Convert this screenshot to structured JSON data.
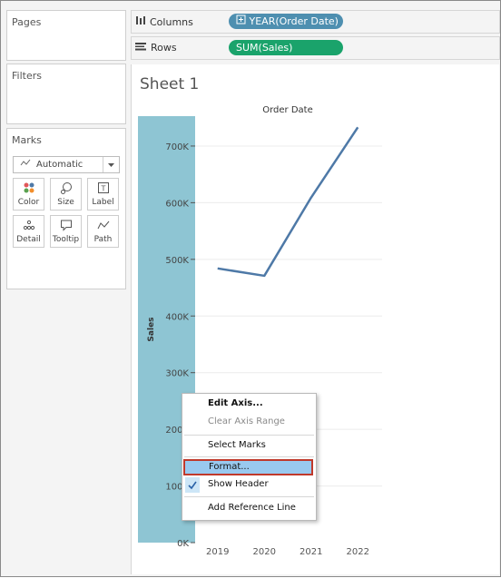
{
  "panels": {
    "pages_title": "Pages",
    "filters_title": "Filters",
    "marks_title": "Marks"
  },
  "shelves": {
    "columns_label": "Columns",
    "columns_pill": "YEAR(Order Date)",
    "rows_label": "Rows",
    "rows_pill": "SUM(Sales)"
  },
  "marks": {
    "type_selected": "Automatic",
    "buttons": [
      "Color",
      "Size",
      "Label",
      "Detail",
      "Tooltip",
      "Path"
    ]
  },
  "sheet": {
    "title": "Sheet 1"
  },
  "colors": {
    "axis_highlight": "#8ec5d3",
    "line": "#4e79a7",
    "pill_dimension": "#4e8fb0",
    "pill_measure": "#1aa36b",
    "menu_highlight": "#99c9ef",
    "menu_highlight_border": "#c0392b"
  },
  "chart_data": {
    "type": "line",
    "title": "Order Date",
    "xlabel": "",
    "ylabel": "Sales",
    "categories": [
      "2019",
      "2020",
      "2021",
      "2022"
    ],
    "values": [
      484000,
      471000,
      609000,
      733000
    ],
    "ylim": [
      0,
      780000
    ],
    "yticks": [
      0,
      100000,
      200000,
      300000,
      400000,
      500000,
      600000,
      700000
    ],
    "ytick_labels": [
      "0K",
      "100K",
      "200K",
      "300K",
      "400K",
      "500K",
      "600K",
      "700K"
    ],
    "grid": true
  },
  "context_menu": {
    "items": [
      {
        "label": "Edit Axis...",
        "enabled": true,
        "bold": true
      },
      {
        "label": "Clear Axis Range",
        "enabled": false
      },
      {
        "label": "Select Marks",
        "enabled": true
      },
      {
        "label": "Format...",
        "enabled": true,
        "highlighted": true
      },
      {
        "label": "Show Header",
        "enabled": true,
        "checked": true
      },
      {
        "label": "Add Reference Line",
        "enabled": true
      }
    ]
  }
}
